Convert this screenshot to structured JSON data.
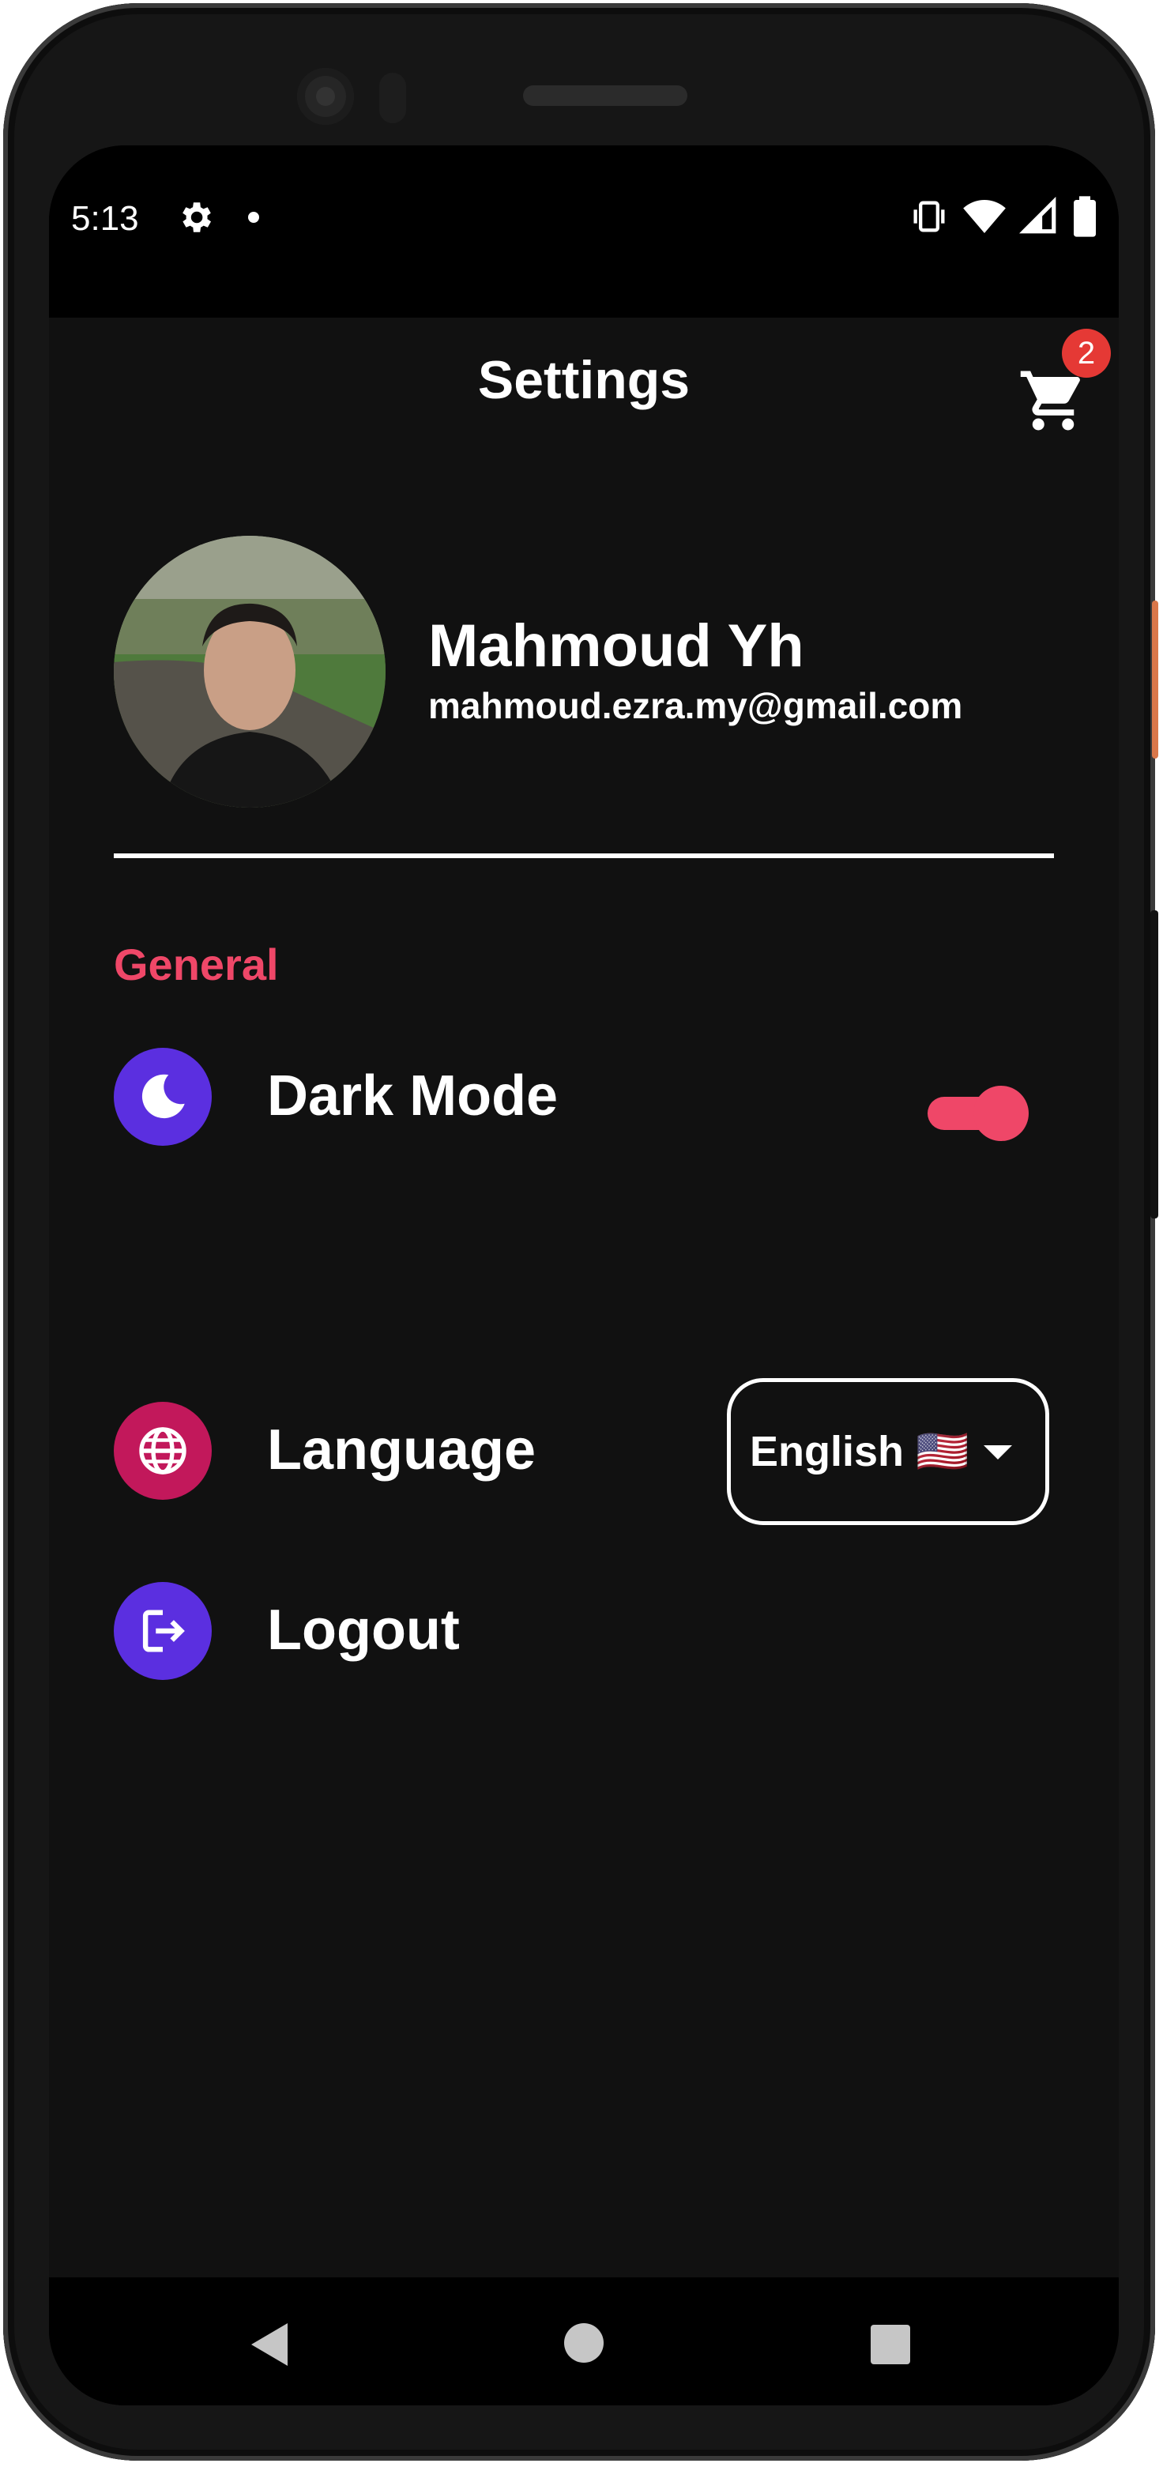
{
  "status_bar": {
    "time": "5:13"
  },
  "app_bar": {
    "title": "Settings",
    "cart_badge": "2"
  },
  "profile": {
    "name": "Mahmoud Yh",
    "email": "mahmoud.ezra.my@gmail.com"
  },
  "general": {
    "section_title": "General",
    "dark_mode": {
      "label": "Dark Mode",
      "enabled": true
    },
    "language": {
      "label": "Language",
      "selected": "English 🇺🇸"
    },
    "logout": {
      "label": "Logout"
    }
  },
  "colors": {
    "accent": "#ef4768",
    "dark_mode_icon_bg": "#5b2fe0",
    "language_icon_bg": "#c2185b",
    "logout_icon_bg": "#5b2fe0",
    "background": "#111111",
    "badge": "#e53935"
  },
  "bottom_nav": {
    "items": [
      {
        "icon": "home-icon",
        "active": false
      },
      {
        "icon": "categories-icon",
        "active": false
      },
      {
        "icon": "heart-icon",
        "active": false
      },
      {
        "icon": "gear-icon",
        "active": true
      }
    ]
  }
}
